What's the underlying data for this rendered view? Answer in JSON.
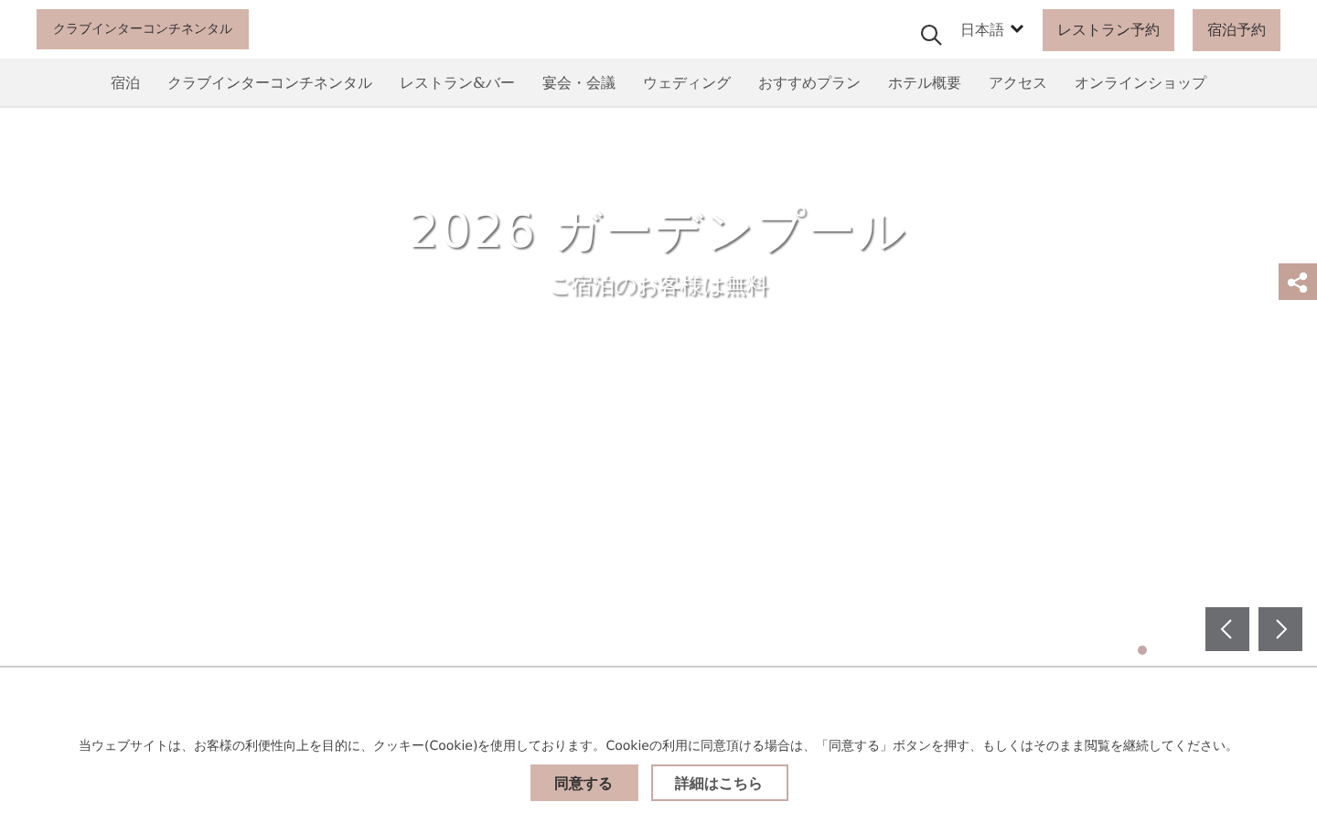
{
  "header": {
    "logo": "クラブインターコンチネンタル",
    "language": "日本語",
    "buttons": [
      "レストラン予約",
      "宿泊予約"
    ]
  },
  "nav": [
    "宿泊",
    "クラブインターコンチネンタル",
    "レストラン&バー",
    "宴会・会議",
    "ウェディング",
    "おすすめプラン",
    "ホテル概要",
    "アクセス",
    "オンラインショップ"
  ],
  "hero": {
    "title": "2026 ガーデンプール",
    "subtitle": "ご宿泊のお客様は無料",
    "dots": [
      {
        "selected": true
      }
    ]
  },
  "cookie": {
    "message": "当ウェブサイトは、お客様の利便性向上を目的に、クッキー(Cookie)を使用しております。Cookieの利用に同意頂ける場合は、「同意する」ボタンを押す、もしくはそのまま閲覧を継続してください。",
    "accept": "同意する",
    "details": "詳細はこちら"
  }
}
